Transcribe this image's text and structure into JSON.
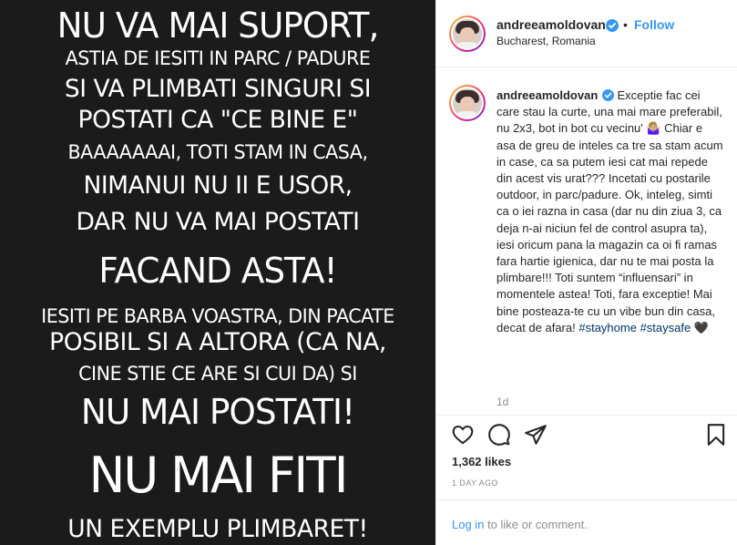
{
  "post_image": {
    "lines": [
      {
        "text": "NU VA MAI SUPORT,",
        "size": "l"
      },
      {
        "text": "ASTIA DE IESITI IN PARC / PADURE",
        "size": "s"
      },
      {
        "text": "SI VA PLIMBATI SINGURI SI",
        "size": "m"
      },
      {
        "text": "POSTATI CA \"CE BINE E\"",
        "size": "m"
      },
      {
        "text": "BAAAAAAAI, TOTI STAM IN CASA,",
        "size": "s"
      },
      {
        "text": "NIMANUI NU II E USOR,",
        "size": "m"
      },
      {
        "text": "DAR NU VA MAI POSTATI",
        "size": "m"
      },
      {
        "text": "FACAND ASTA!",
        "size": "l"
      },
      {
        "text": "IESITI PE BARBA VOASTRA, DIN PACATE",
        "size": "s"
      },
      {
        "text": "POSIBIL SI A ALTORA (CA NA,",
        "size": "m"
      },
      {
        "text": "CINE STIE CE ARE SI CUI DA) SI",
        "size": "s"
      },
      {
        "text": "NU MAI POSTATI!",
        "size": "l"
      },
      {
        "text": "NU MAI FITI",
        "size": "xl"
      },
      {
        "text": "UN EXEMPLU PLIMBARET!",
        "size": "m"
      }
    ]
  },
  "header": {
    "username": "andreeamoldovan",
    "dot": "•",
    "follow_label": "Follow",
    "location": "Bucharest, Romania"
  },
  "caption": {
    "username": "andreeamoldovan",
    "text": "Exceptie fac cei care stau la curte, una mai mare preferabil, nu 2x3, bot in bot cu vecinu' 🤷🏼‍♀️ Chiar e asa de greu de inteles ca tre sa stam acum in case, ca sa putem iesi cat mai repede din acest vis urat??? Incetati cu postarile outdoor, in parc/padure. Ok, inteleg, simti ca o iei razna in casa (dar nu din ziua 3, ca deja n-ai niciun fel de control asupra ta), iesi oricum pana la magazin ca oi fi ramas fara hartie igienica, dar nu te mai posta la plimbare!!! Toti suntem “influensari” in momentele astea! Toti, fara exceptie! Mai bine posteaza-te cu un vibe bun din casa, decat de afara!",
    "hashtag_1": "#stayhome",
    "hashtag_2": "#staysafe",
    "heart": "🖤",
    "time_ago": "1d"
  },
  "actions": {
    "likes": "1,362 likes",
    "date": "1 DAY AGO"
  },
  "comment": {
    "login_label": "Log in",
    "suffix": " to like or comment."
  },
  "colors": {
    "accent": "#3897f0",
    "verified": "#3897f0",
    "image_bg": "#1b1b1b"
  }
}
